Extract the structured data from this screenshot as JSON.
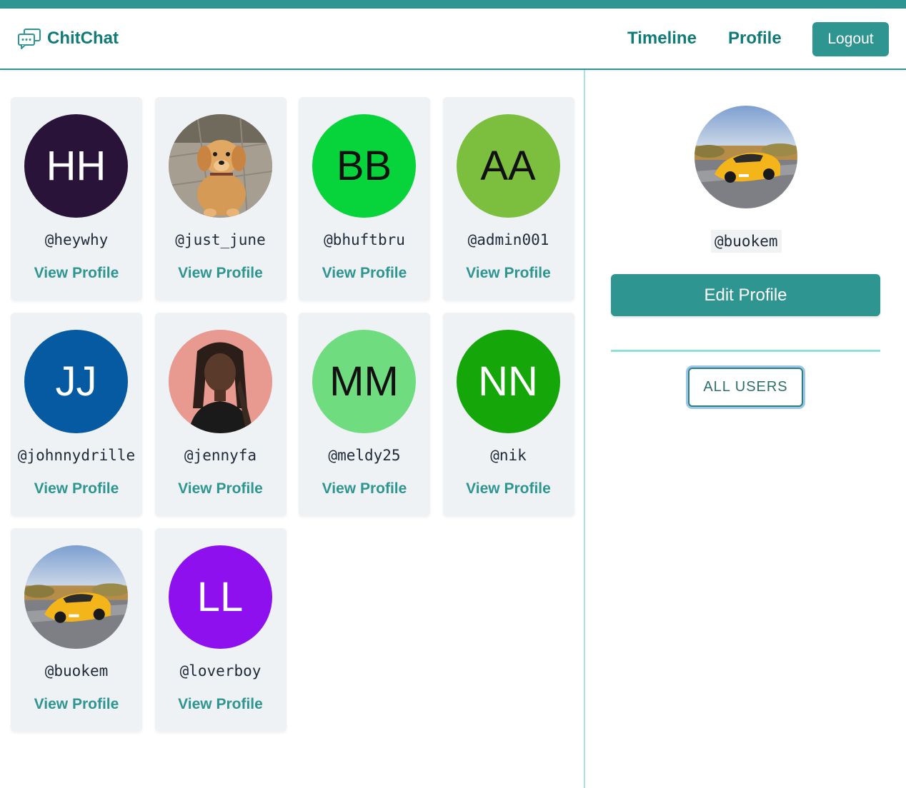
{
  "header": {
    "app_name": "ChitChat",
    "nav": {
      "timeline": "Timeline",
      "profile": "Profile"
    },
    "logout_label": "Logout"
  },
  "colors": {
    "accent": "#2f9591",
    "brand_text": "#117c76"
  },
  "users": [
    {
      "initials": "HH",
      "username": "@heywhy",
      "avatar_bg": "#2a1338",
      "text_color": "#ffffff",
      "photo": null
    },
    {
      "initials": "",
      "username": "@just_june",
      "avatar_bg": "#9a8f82",
      "text_color": "#ffffff",
      "photo": "puppy"
    },
    {
      "initials": "BB",
      "username": "@bhuftbru",
      "avatar_bg": "#06d43a",
      "text_color": "#111111",
      "photo": null
    },
    {
      "initials": "AA",
      "username": "@admin001",
      "avatar_bg": "#7cbf3f",
      "text_color": "#111111",
      "photo": null
    },
    {
      "initials": "JJ",
      "username": "@johnnydrille",
      "avatar_bg": "#055aa1",
      "text_color": "#ffffff",
      "photo": null
    },
    {
      "initials": "",
      "username": "@jennyfa",
      "avatar_bg": "#e99a90",
      "text_color": "#ffffff",
      "photo": "woman"
    },
    {
      "initials": "MM",
      "username": "@meldy25",
      "avatar_bg": "#6fdc7f",
      "text_color": "#111111",
      "photo": null
    },
    {
      "initials": "NN",
      "username": "@nik",
      "avatar_bg": "#15a70a",
      "text_color": "#ffffff",
      "photo": null
    },
    {
      "initials": "",
      "username": "@buokem",
      "avatar_bg": "#9fb7d4",
      "text_color": "#ffffff",
      "photo": "car"
    },
    {
      "initials": "LL",
      "username": "@loverboy",
      "avatar_bg": "#8e10ef",
      "text_color": "#ffffff",
      "photo": null
    }
  ],
  "view_profile_label": "View Profile",
  "sidebar": {
    "username": "@buokem",
    "edit_profile_label": "Edit Profile",
    "all_users_label": "ALL USERS"
  }
}
